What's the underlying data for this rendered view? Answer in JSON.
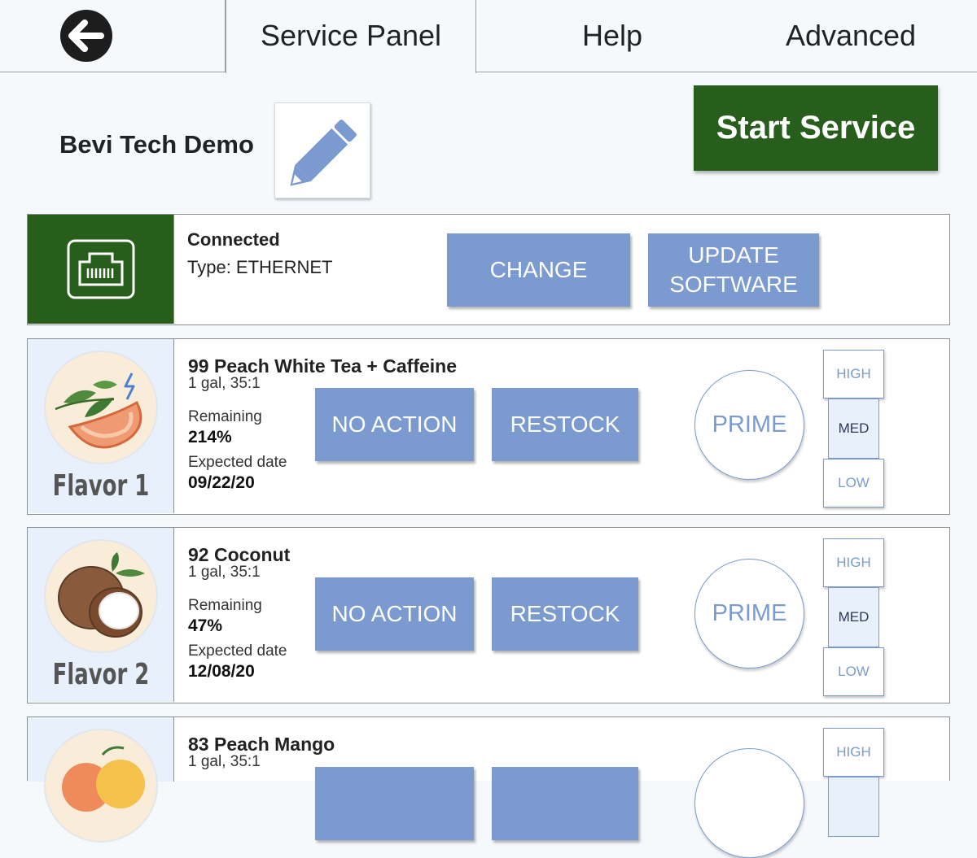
{
  "tabs": {
    "back_icon": "arrow-left-icon",
    "service_panel": "Service Panel",
    "help": "Help",
    "advanced": "Advanced"
  },
  "header": {
    "device_name": "Bevi Tech Demo",
    "edit_icon": "pencil-icon",
    "start_service": "Start Service"
  },
  "network": {
    "icon": "ethernet-icon",
    "status": "Connected",
    "type": "Type: ETHERNET",
    "change_label": "CHANGE",
    "update_label": "UPDATE SOFTWARE"
  },
  "colors": {
    "accent_green": "#285e1c",
    "button_blue": "#7a9ad0",
    "flavor_panel": "#e7f0fb"
  },
  "flavors": [
    {
      "slot": "Flavor 1",
      "icon": "peach-tea-icon",
      "caffeine_icon": "lightning-icon",
      "name": "99 Peach White Tea + Caffeine",
      "size": "1 gal, 35:1",
      "remaining_label": "Remaining",
      "remaining": "214%",
      "expected_label": "Expected date",
      "expected": "09/22/20",
      "no_action": "NO ACTION",
      "restock": "RESTOCK",
      "prime": "PRIME",
      "high": "HIGH",
      "med": "MED",
      "low": "LOW",
      "selected_level": "MED"
    },
    {
      "slot": "Flavor 2",
      "icon": "coconut-icon",
      "name": "92 Coconut",
      "size": "1 gal, 35:1",
      "remaining_label": "Remaining",
      "remaining": "47%",
      "expected_label": "Expected date",
      "expected": "12/08/20",
      "no_action": "NO ACTION",
      "restock": "RESTOCK",
      "prime": "PRIME",
      "high": "HIGH",
      "med": "MED",
      "low": "LOW",
      "selected_level": "MED"
    },
    {
      "icon": "peach-mango-icon",
      "name": "83 Peach Mango",
      "size": "1 gal, 35:1",
      "high": "HIGH"
    }
  ]
}
